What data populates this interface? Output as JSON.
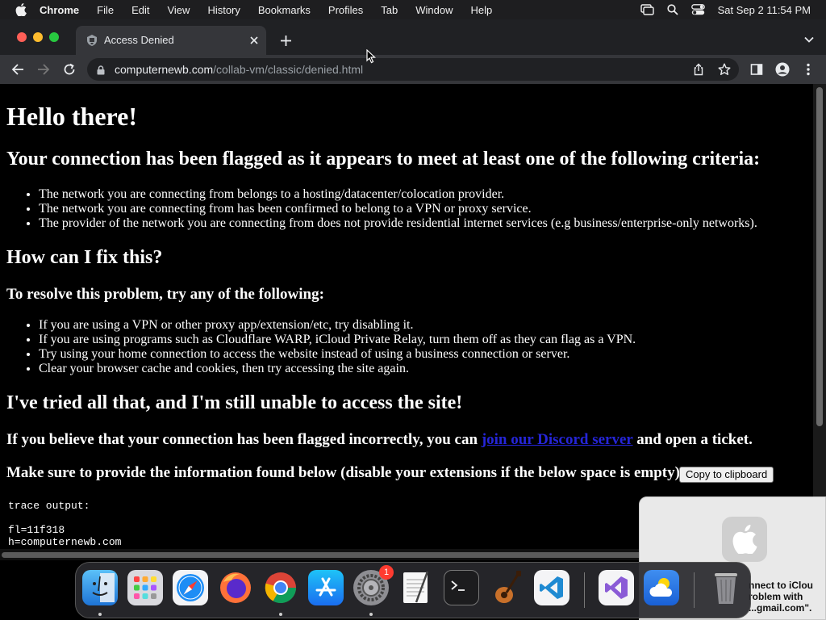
{
  "menubar": {
    "app_name": "Chrome",
    "items": [
      "File",
      "Edit",
      "View",
      "History",
      "Bookmarks",
      "Profiles",
      "Tab",
      "Window",
      "Help"
    ],
    "clock": "Sat Sep 2  11:54 PM"
  },
  "tab": {
    "title": "Access Denied"
  },
  "omnibox": {
    "host": "computernewb.com",
    "path": "/collab-vm/classic/denied.html"
  },
  "page": {
    "title": "Hello there!",
    "flagged_heading": "Your connection has been flagged as it appears to meet at least one of the following criteria:",
    "criteria": [
      "The network you are connecting from belongs to a hosting/datacenter/colocation provider.",
      "The network you are connecting from has been confirmed to belong to a VPN or proxy service.",
      "The provider of the network you are connecting from does not provide residential internet services (e.g business/enterprise-only networks)."
    ],
    "fix_heading": "How can I fix this?",
    "resolve_heading": "To resolve this problem, try any of the following:",
    "fixes": [
      "If you are using a VPN or other proxy app/extension/etc, try disabling it.",
      "If you are using programs such as Cloudflare WARP, iCloud Private Relay, turn them off as they can flag as a VPN.",
      "Try using your home connection to access the website instead of using a business connection or server.",
      "Clear your browser cache and cookies, then try accessing the site again."
    ],
    "tried_heading": "I've tried all that, and I'm still unable to access the site!",
    "incorrect_prefix": "If you believe that your connection has been flagged incorrectly, you can ",
    "discord_link": "join our Discord server",
    "incorrect_suffix": " and open a ticket.",
    "provide_info": "Make sure to provide the information found below (disable your extensions if the below space is empty):",
    "copy_button": "Copy to clipboard",
    "trace_label": "trace output:",
    "trace_lines": [
      "fl=11f318",
      "h=computernewb.com"
    ]
  },
  "notification": {
    "lines": [
      "nnect to iClou",
      "roblem with",
      "...gmail.com\"."
    ]
  },
  "dock": {
    "settings_badge": "1"
  },
  "colors": {
    "menubar_bg": "#1e1e20",
    "tabstrip_bg": "#202124",
    "toolbar_bg": "#35363a",
    "page_bg": "#000000",
    "link": "#2525d8"
  }
}
